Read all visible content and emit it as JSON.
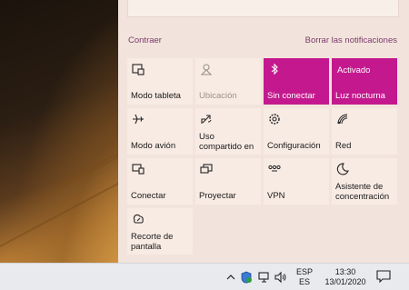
{
  "action_center": {
    "collapse_label": "Contraer",
    "clear_label": "Borrar las notificaciones",
    "tiles": [
      {
        "id": "tablet-mode",
        "label": "Modo tableta",
        "icon": "tablet-mode-icon",
        "state": "normal"
      },
      {
        "id": "location",
        "label": "Ubicación",
        "icon": "location-icon",
        "state": "disabled"
      },
      {
        "id": "bluetooth",
        "label": "Sin conectar",
        "icon": "bluetooth-icon",
        "state": "active"
      },
      {
        "id": "night-light",
        "label": "Luz nocturna",
        "top_label": "Activado",
        "state": "active"
      },
      {
        "id": "airplane-mode",
        "label": "Modo avión",
        "icon": "airplane-icon",
        "state": "normal"
      },
      {
        "id": "project-share",
        "label": "Uso compartido en",
        "icon": "share-icon",
        "state": "normal"
      },
      {
        "id": "settings",
        "label": "Configuración",
        "icon": "gear-icon",
        "state": "normal"
      },
      {
        "id": "network",
        "label": "Red",
        "icon": "network-icon",
        "state": "normal"
      },
      {
        "id": "connect",
        "label": "Conectar",
        "icon": "connect-icon",
        "state": "normal"
      },
      {
        "id": "project",
        "label": "Proyectar",
        "icon": "project-icon",
        "state": "normal"
      },
      {
        "id": "vpn",
        "label": "VPN",
        "icon": "vpn-icon",
        "state": "normal"
      },
      {
        "id": "focus-assist",
        "label": "Asistente de concentración",
        "icon": "moon-icon",
        "state": "normal"
      },
      {
        "id": "snip",
        "label": "Recorte de pantalla",
        "icon": "snip-icon",
        "state": "normal"
      }
    ]
  },
  "taskbar": {
    "language_top": "ESP",
    "language_bottom": "ES",
    "time": "13:30",
    "date": "13/01/2020"
  },
  "colors": {
    "accent": "#c4198e",
    "panel_bg": "#f2e4dc",
    "tile_bg": "#f8ebe4",
    "link": "#7a3a6b"
  }
}
